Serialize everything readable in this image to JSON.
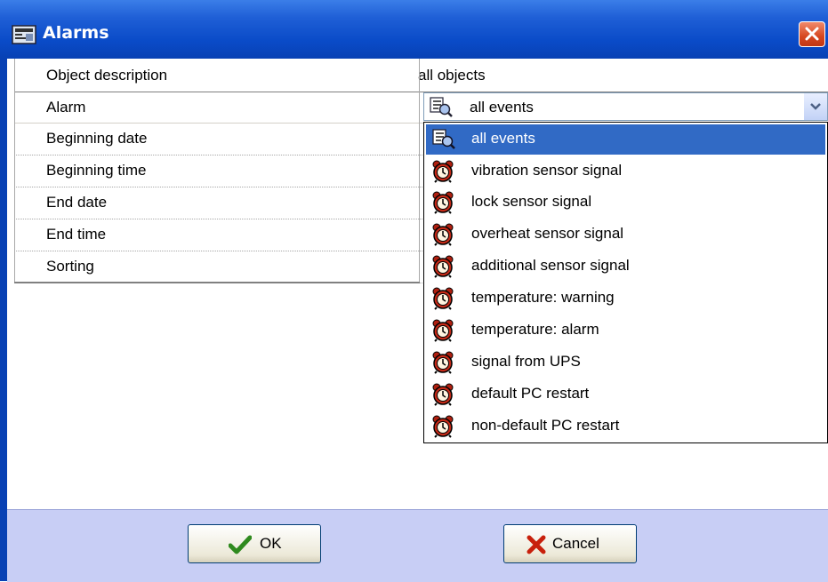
{
  "window": {
    "title": "Alarms",
    "title_icon": "window-icon",
    "close_icon": "close-icon"
  },
  "grid": {
    "rows": [
      {
        "name": "Object description",
        "value": "all objects"
      },
      {
        "name": "Alarm",
        "value": ""
      },
      {
        "name": "Beginning date",
        "value": ""
      },
      {
        "name": "Beginning time",
        "value": ""
      },
      {
        "name": "End date",
        "value": ""
      },
      {
        "name": "End time",
        "value": ""
      },
      {
        "name": "Sorting",
        "value": ""
      }
    ]
  },
  "alarm_combo": {
    "selected": "all events",
    "selected_icon": "all-events-icon",
    "dropdown_icon": "chevron-down-icon"
  },
  "alarm_options": [
    {
      "label": "all events",
      "icon": "all-events-icon",
      "selected": true
    },
    {
      "label": "vibration sensor signal",
      "icon": "alarm-clock-icon"
    },
    {
      "label": "lock sensor signal",
      "icon": "alarm-clock-icon"
    },
    {
      "label": "overheat sensor signal",
      "icon": "alarm-clock-icon"
    },
    {
      "label": "additional sensor signal",
      "icon": "alarm-clock-icon"
    },
    {
      "label": "temperature: warning",
      "icon": "alarm-clock-icon"
    },
    {
      "label": "temperature: alarm",
      "icon": "alarm-clock-icon"
    },
    {
      "label": "signal from UPS",
      "icon": "alarm-clock-icon"
    },
    {
      "label": "default PC restart",
      "icon": "alarm-clock-icon"
    },
    {
      "label": "non-default PC restart",
      "icon": "alarm-clock-icon"
    }
  ],
  "buttons": {
    "ok_label": "OK",
    "cancel_label": "Cancel"
  },
  "colors": {
    "title_bar": "#0a4bc8",
    "selection": "#316ac5",
    "footer": "#c8cef5",
    "alarm_clock_red": "#b02010"
  }
}
